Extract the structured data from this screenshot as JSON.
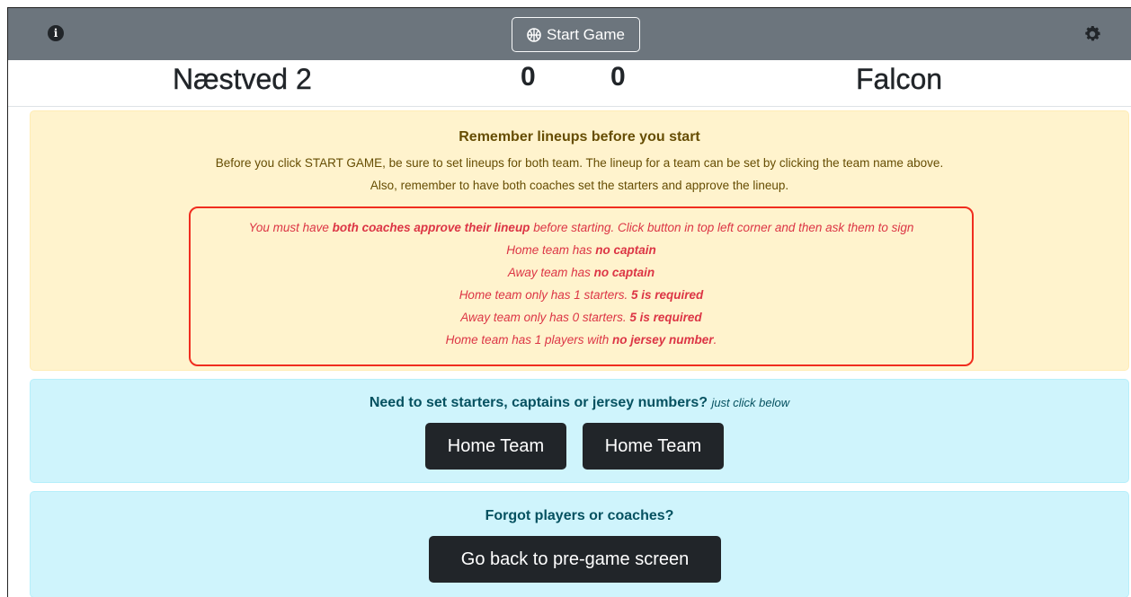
{
  "topbar": {
    "start_label": "Start Game",
    "info_icon": "info-circle-icon",
    "settings_icon": "gear-icon",
    "bar_color": "#6c757d"
  },
  "scoreboard": {
    "home_team": "Næstved 2",
    "home_score": "0",
    "away_score": "0",
    "away_team": "Falcon"
  },
  "lineup_warning": {
    "title": "Remember lineups before you start",
    "line1": "Before you click START GAME, be sure to set lineups for both team. The lineup for a team can be set by clicking the team name above.",
    "line2": "Also, remember to have both coaches set the starters and approve the lineup.",
    "background_color": "#fff3cd"
  },
  "errors": {
    "approve_pre": "You must have ",
    "approve_bold": "both coaches approve their lineup",
    "approve_post": " before starting. Click button in top left corner and then ask them to sign",
    "home_captain_pre": "Home team has ",
    "home_captain_bold": "no captain",
    "away_captain_pre": "Away team has ",
    "away_captain_bold": "no captain",
    "home_starters_pre": "Home team only has 1 starters. ",
    "home_starters_bold": "5 is required",
    "away_starters_pre": "Away team only has 0 starters. ",
    "away_starters_bold": "5 is required",
    "jersey_pre": "Home team has 1 players with ",
    "jersey_bold": "no jersey number",
    "jersey_post": ".",
    "border_color": "#f02d1f",
    "text_color": "#dc3545"
  },
  "starters_panel": {
    "title": "Need to set starters, captains or jersey numbers?",
    "hint": "just click below",
    "home_button": "Home Team",
    "away_button": "Home Team"
  },
  "pregame_panel": {
    "title": "Forgot players or coaches?",
    "back_button": "Go back to pre-game screen",
    "background_color": "#cff4fc"
  }
}
